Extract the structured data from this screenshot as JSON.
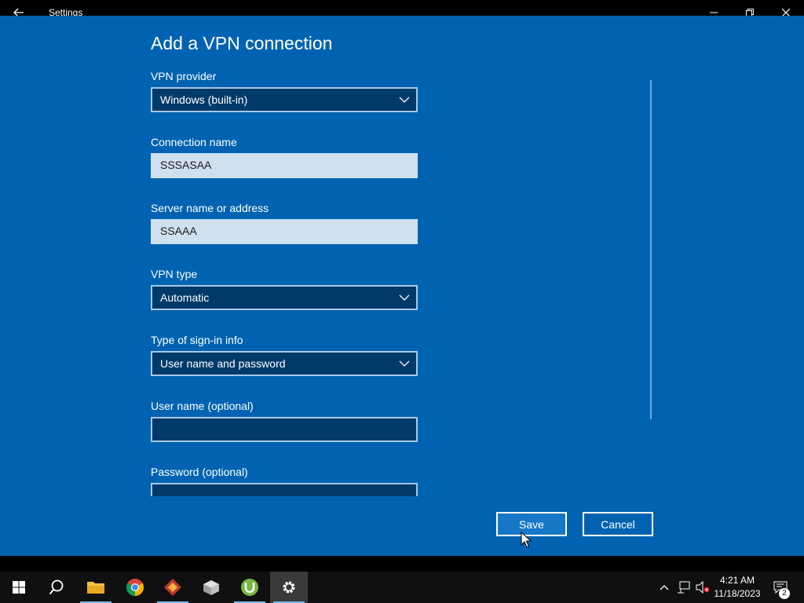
{
  "window": {
    "title": "Settings",
    "back_icon": "arrow-left-icon",
    "minimize_icon": "minimize-icon",
    "maximize_icon": "restore-icon",
    "close_icon": "close-icon"
  },
  "dialog": {
    "heading": "Add a VPN connection",
    "fields": {
      "vpn_provider": {
        "label": "VPN provider",
        "value": "Windows (built-in)"
      },
      "connection_name": {
        "label": "Connection name",
        "value": "SSSASAA"
      },
      "server_name": {
        "label": "Server name or address",
        "value": "SSAAA"
      },
      "vpn_type": {
        "label": "VPN type",
        "value": "Automatic"
      },
      "sign_in_type": {
        "label": "Type of sign-in info",
        "value": "User name and password"
      },
      "user_name": {
        "label": "User name (optional)",
        "value": ""
      },
      "password": {
        "label": "Password (optional)",
        "value": ""
      }
    },
    "buttons": {
      "save": "Save",
      "cancel": "Cancel"
    }
  },
  "taskbar": {
    "apps": [
      {
        "name": "start",
        "icon": "windows-logo-icon"
      },
      {
        "name": "search",
        "icon": "search-icon"
      },
      {
        "name": "file-explorer",
        "icon": "folder-icon"
      },
      {
        "name": "chrome",
        "icon": "chrome-icon"
      },
      {
        "name": "app-red",
        "icon": "red-diamond-app-icon"
      },
      {
        "name": "app-box",
        "icon": "package-icon"
      },
      {
        "name": "utorrent",
        "icon": "utorrent-icon"
      },
      {
        "name": "settings",
        "icon": "gear-icon"
      }
    ],
    "clock": {
      "time": "4:21 AM",
      "date": "11/18/2023"
    },
    "notification_count": "2"
  },
  "colors": {
    "dialog_bg": "#0063b1",
    "field_dark": "#003a6b",
    "field_light": "#cfe0ee",
    "accent_underline": "#76b9ed"
  }
}
